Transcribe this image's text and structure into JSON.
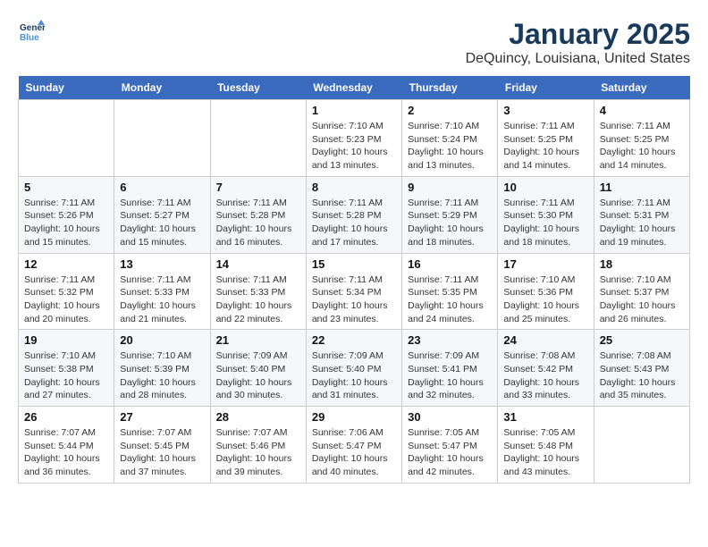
{
  "header": {
    "logo_line1": "General",
    "logo_line2": "Blue",
    "month": "January 2025",
    "location": "DeQuincy, Louisiana, United States"
  },
  "weekdays": [
    "Sunday",
    "Monday",
    "Tuesday",
    "Wednesday",
    "Thursday",
    "Friday",
    "Saturday"
  ],
  "weeks": [
    [
      {
        "day": "",
        "sunrise": "",
        "sunset": "",
        "daylight": ""
      },
      {
        "day": "",
        "sunrise": "",
        "sunset": "",
        "daylight": ""
      },
      {
        "day": "",
        "sunrise": "",
        "sunset": "",
        "daylight": ""
      },
      {
        "day": "1",
        "sunrise": "Sunrise: 7:10 AM",
        "sunset": "Sunset: 5:23 PM",
        "daylight": "Daylight: 10 hours and 13 minutes."
      },
      {
        "day": "2",
        "sunrise": "Sunrise: 7:10 AM",
        "sunset": "Sunset: 5:24 PM",
        "daylight": "Daylight: 10 hours and 13 minutes."
      },
      {
        "day": "3",
        "sunrise": "Sunrise: 7:11 AM",
        "sunset": "Sunset: 5:25 PM",
        "daylight": "Daylight: 10 hours and 14 minutes."
      },
      {
        "day": "4",
        "sunrise": "Sunrise: 7:11 AM",
        "sunset": "Sunset: 5:25 PM",
        "daylight": "Daylight: 10 hours and 14 minutes."
      }
    ],
    [
      {
        "day": "5",
        "sunrise": "Sunrise: 7:11 AM",
        "sunset": "Sunset: 5:26 PM",
        "daylight": "Daylight: 10 hours and 15 minutes."
      },
      {
        "day": "6",
        "sunrise": "Sunrise: 7:11 AM",
        "sunset": "Sunset: 5:27 PM",
        "daylight": "Daylight: 10 hours and 15 minutes."
      },
      {
        "day": "7",
        "sunrise": "Sunrise: 7:11 AM",
        "sunset": "Sunset: 5:28 PM",
        "daylight": "Daylight: 10 hours and 16 minutes."
      },
      {
        "day": "8",
        "sunrise": "Sunrise: 7:11 AM",
        "sunset": "Sunset: 5:28 PM",
        "daylight": "Daylight: 10 hours and 17 minutes."
      },
      {
        "day": "9",
        "sunrise": "Sunrise: 7:11 AM",
        "sunset": "Sunset: 5:29 PM",
        "daylight": "Daylight: 10 hours and 18 minutes."
      },
      {
        "day": "10",
        "sunrise": "Sunrise: 7:11 AM",
        "sunset": "Sunset: 5:30 PM",
        "daylight": "Daylight: 10 hours and 18 minutes."
      },
      {
        "day": "11",
        "sunrise": "Sunrise: 7:11 AM",
        "sunset": "Sunset: 5:31 PM",
        "daylight": "Daylight: 10 hours and 19 minutes."
      }
    ],
    [
      {
        "day": "12",
        "sunrise": "Sunrise: 7:11 AM",
        "sunset": "Sunset: 5:32 PM",
        "daylight": "Daylight: 10 hours and 20 minutes."
      },
      {
        "day": "13",
        "sunrise": "Sunrise: 7:11 AM",
        "sunset": "Sunset: 5:33 PM",
        "daylight": "Daylight: 10 hours and 21 minutes."
      },
      {
        "day": "14",
        "sunrise": "Sunrise: 7:11 AM",
        "sunset": "Sunset: 5:33 PM",
        "daylight": "Daylight: 10 hours and 22 minutes."
      },
      {
        "day": "15",
        "sunrise": "Sunrise: 7:11 AM",
        "sunset": "Sunset: 5:34 PM",
        "daylight": "Daylight: 10 hours and 23 minutes."
      },
      {
        "day": "16",
        "sunrise": "Sunrise: 7:11 AM",
        "sunset": "Sunset: 5:35 PM",
        "daylight": "Daylight: 10 hours and 24 minutes."
      },
      {
        "day": "17",
        "sunrise": "Sunrise: 7:10 AM",
        "sunset": "Sunset: 5:36 PM",
        "daylight": "Daylight: 10 hours and 25 minutes."
      },
      {
        "day": "18",
        "sunrise": "Sunrise: 7:10 AM",
        "sunset": "Sunset: 5:37 PM",
        "daylight": "Daylight: 10 hours and 26 minutes."
      }
    ],
    [
      {
        "day": "19",
        "sunrise": "Sunrise: 7:10 AM",
        "sunset": "Sunset: 5:38 PM",
        "daylight": "Daylight: 10 hours and 27 minutes."
      },
      {
        "day": "20",
        "sunrise": "Sunrise: 7:10 AM",
        "sunset": "Sunset: 5:39 PM",
        "daylight": "Daylight: 10 hours and 28 minutes."
      },
      {
        "day": "21",
        "sunrise": "Sunrise: 7:09 AM",
        "sunset": "Sunset: 5:40 PM",
        "daylight": "Daylight: 10 hours and 30 minutes."
      },
      {
        "day": "22",
        "sunrise": "Sunrise: 7:09 AM",
        "sunset": "Sunset: 5:40 PM",
        "daylight": "Daylight: 10 hours and 31 minutes."
      },
      {
        "day": "23",
        "sunrise": "Sunrise: 7:09 AM",
        "sunset": "Sunset: 5:41 PM",
        "daylight": "Daylight: 10 hours and 32 minutes."
      },
      {
        "day": "24",
        "sunrise": "Sunrise: 7:08 AM",
        "sunset": "Sunset: 5:42 PM",
        "daylight": "Daylight: 10 hours and 33 minutes."
      },
      {
        "day": "25",
        "sunrise": "Sunrise: 7:08 AM",
        "sunset": "Sunset: 5:43 PM",
        "daylight": "Daylight: 10 hours and 35 minutes."
      }
    ],
    [
      {
        "day": "26",
        "sunrise": "Sunrise: 7:07 AM",
        "sunset": "Sunset: 5:44 PM",
        "daylight": "Daylight: 10 hours and 36 minutes."
      },
      {
        "day": "27",
        "sunrise": "Sunrise: 7:07 AM",
        "sunset": "Sunset: 5:45 PM",
        "daylight": "Daylight: 10 hours and 37 minutes."
      },
      {
        "day": "28",
        "sunrise": "Sunrise: 7:07 AM",
        "sunset": "Sunset: 5:46 PM",
        "daylight": "Daylight: 10 hours and 39 minutes."
      },
      {
        "day": "29",
        "sunrise": "Sunrise: 7:06 AM",
        "sunset": "Sunset: 5:47 PM",
        "daylight": "Daylight: 10 hours and 40 minutes."
      },
      {
        "day": "30",
        "sunrise": "Sunrise: 7:05 AM",
        "sunset": "Sunset: 5:47 PM",
        "daylight": "Daylight: 10 hours and 42 minutes."
      },
      {
        "day": "31",
        "sunrise": "Sunrise: 7:05 AM",
        "sunset": "Sunset: 5:48 PM",
        "daylight": "Daylight: 10 hours and 43 minutes."
      },
      {
        "day": "",
        "sunrise": "",
        "sunset": "",
        "daylight": ""
      }
    ]
  ]
}
